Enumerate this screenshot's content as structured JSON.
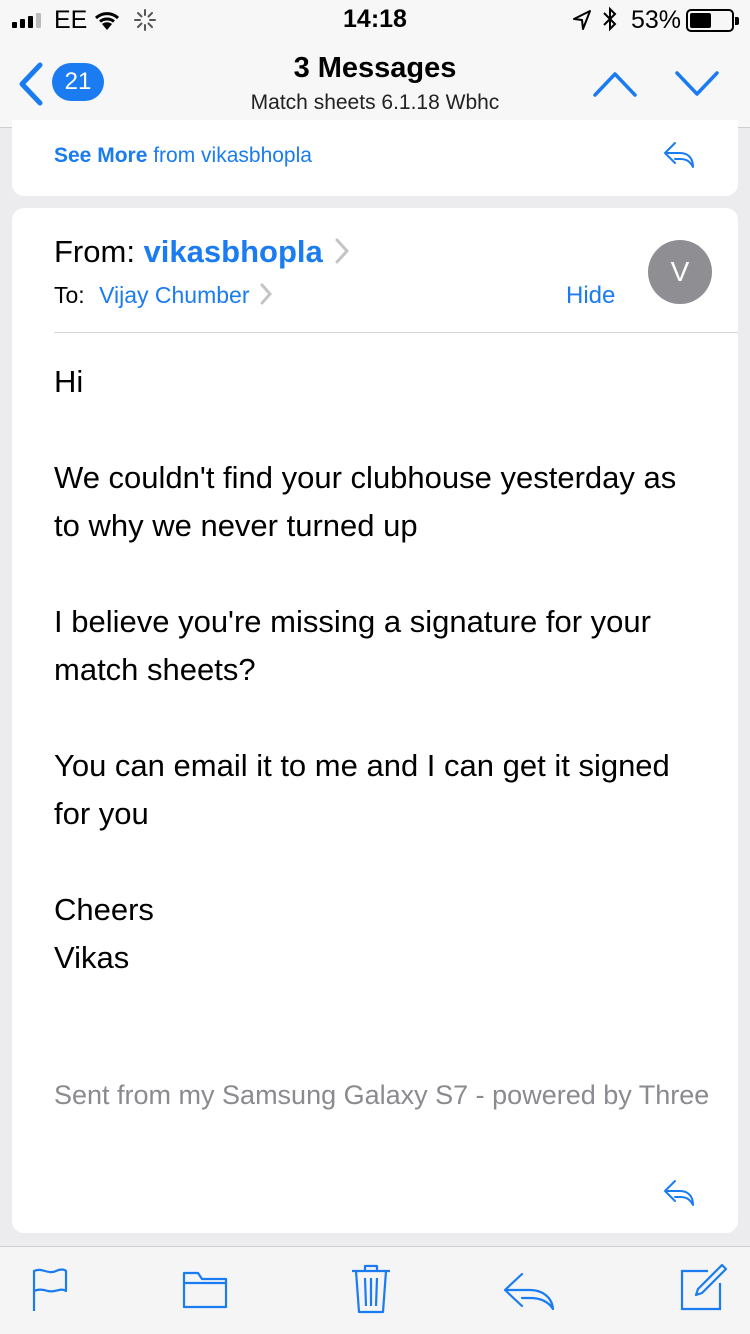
{
  "status_bar": {
    "carrier": "EE",
    "time": "14:18",
    "battery_percent": "53%",
    "battery_level": 0.53,
    "icons": [
      "signal-icon",
      "wifi-icon",
      "activity-spinner-icon",
      "location-arrow-icon",
      "bluetooth-icon",
      "battery-icon"
    ]
  },
  "nav": {
    "back_badge": "21",
    "title": "3 Messages",
    "subtitle": "Match sheets 6.1.18 Wbhc",
    "icons": [
      "back-chevron-icon",
      "chevron-up-icon",
      "chevron-down-icon"
    ]
  },
  "collapsed": {
    "see_more": "See More",
    "from_text": "from vikasbhopla"
  },
  "message": {
    "from_label": "From:",
    "sender": "vikasbhopla",
    "to_label": "To:",
    "recipient": "Vijay Chumber",
    "hide_label": "Hide",
    "avatar_initial": "V",
    "body": {
      "greeting": "Hi",
      "p1": "We couldn't find your clubhouse yesterday as to why we never turned up",
      "p2": "I believe you're missing a signature for your match sheets?",
      "p3": "You can email it to me and I can get it signed for you",
      "closing": "Cheers",
      "name": "Vikas"
    },
    "footer": "Sent from my Samsung Galaxy S7 - powered by Three"
  },
  "toolbar": {
    "icons": [
      "flag-icon",
      "folder-icon",
      "trash-icon",
      "reply-icon",
      "compose-icon"
    ]
  },
  "colors": {
    "accent": "#1a7cf0",
    "avatar": "#8e8e93",
    "footer_text": "#8a8a8f",
    "background": "#ececee"
  }
}
